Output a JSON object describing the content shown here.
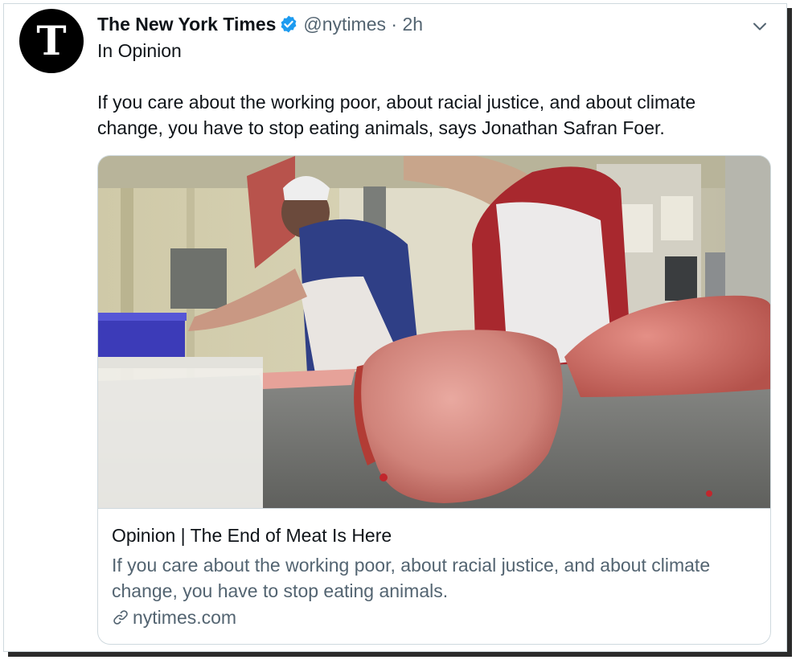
{
  "tweet": {
    "author": {
      "name": "The New York Times",
      "handle": "@nytimes",
      "separator": "·",
      "time": "2h",
      "avatar_glyph": "T",
      "verified": true
    },
    "context": "In Opinion",
    "text": "If you care about the working poor, about racial justice, and about climate change, you have to stop eating animals, says Jonathan Safran Foer.",
    "card": {
      "title": "Opinion | The End of Meat Is Here",
      "description": "If you care about the working poor, about racial justice, and about climate change, you have to stop eating animals.",
      "domain": "nytimes.com",
      "image_icon": "butcher-shop-photo"
    }
  },
  "colors": {
    "text_primary": "#0f1419",
    "text_secondary": "#536471",
    "verified_blue": "#1d9bf0",
    "border": "#cfd9de"
  }
}
